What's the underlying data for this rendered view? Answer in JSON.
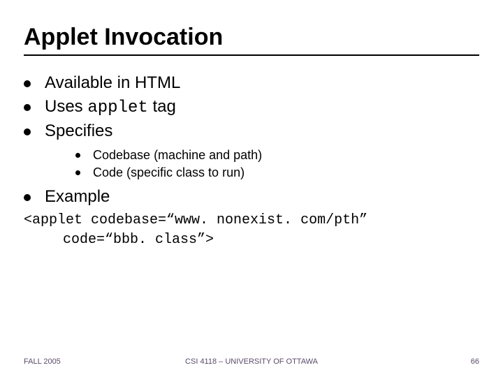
{
  "title": "Applet Invocation",
  "bullets": {
    "b0": "Available in HTML",
    "b1_pre": "Uses ",
    "b1_mono": "applet",
    "b1_post": " tag",
    "b2": "Specifies",
    "s0": "Codebase (machine and path)",
    "s1": "Code (specific class to run)",
    "b3": "Example"
  },
  "code": {
    "line1": "<applet codebase=“www. nonexist. com/pth”",
    "line2": "code=“bbb. class”>"
  },
  "footer": {
    "left": "FALL 2005",
    "center": "CSI 4118 – UNIVERSITY OF OTTAWA",
    "right": "66"
  }
}
